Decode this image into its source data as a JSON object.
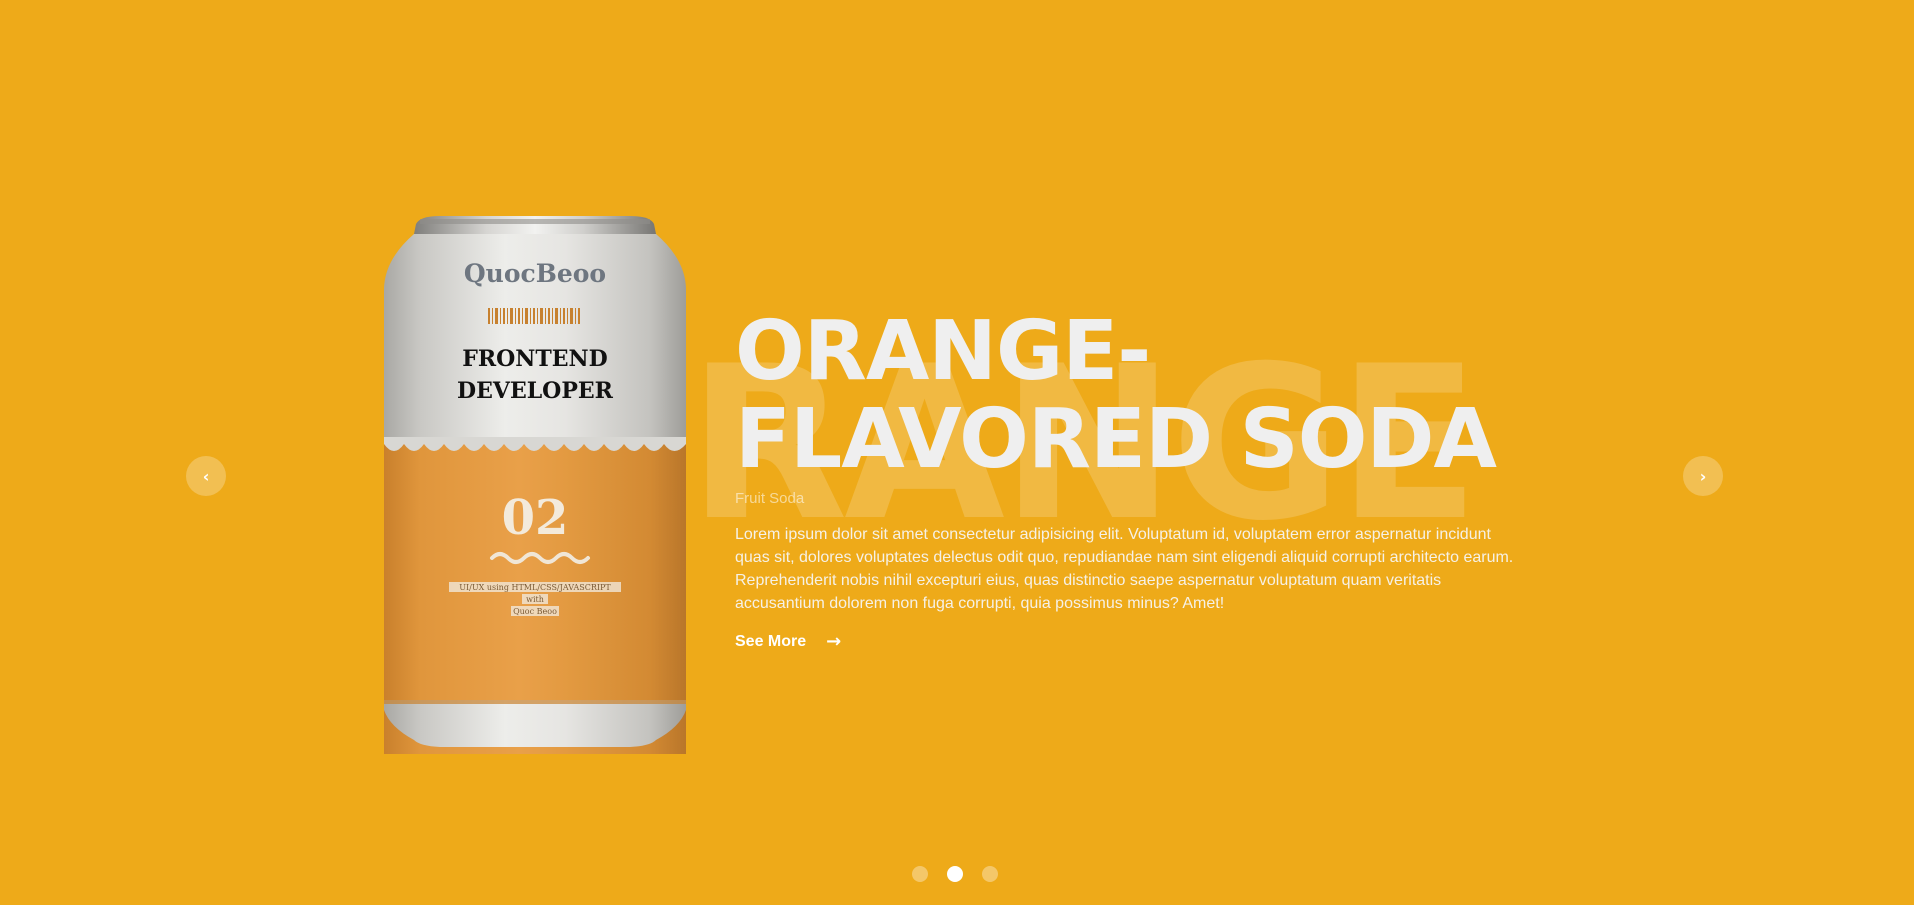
{
  "slide": {
    "bg_word": "RANGE",
    "title_line1": "ORANGE-",
    "title_line2": "FLAVORED SODA",
    "subtitle": "Fruit Soda",
    "description": "Lorem ipsum dolor sit amet consectetur adipisicing elit. Voluptatum id, voluptatem error aspernatur incidunt quas sit, dolores voluptates delectus odit quo, repudiandae nam sint eligendi aliquid corrupti architecto earum. Reprehenderit nobis nihil excepturi eius, quas distinctio saepe aspernatur voluptatum quam veritatis accusantium dolorem non fuga corrupti, quia possimus minus? Amet!",
    "see_more_label": "See More",
    "see_more_arrow": "→"
  },
  "can": {
    "brand": "QuocBeoo",
    "headline_line1": "FRONTEND",
    "headline_line2": "DEVELOPER",
    "number": "02",
    "tag_line1": "UI/UX using HTML/CSS/JAVASCRIPT",
    "tag_line2": "with",
    "tag_line3": "Quoc Beoo"
  },
  "nav": {
    "prev_icon": "‹",
    "next_icon": "›"
  },
  "pagination": {
    "count": 3,
    "active_index": 1
  },
  "colors": {
    "background": "#EEAA19",
    "can_orange": "#E49A3E",
    "can_silver": "#D3D2CE"
  }
}
